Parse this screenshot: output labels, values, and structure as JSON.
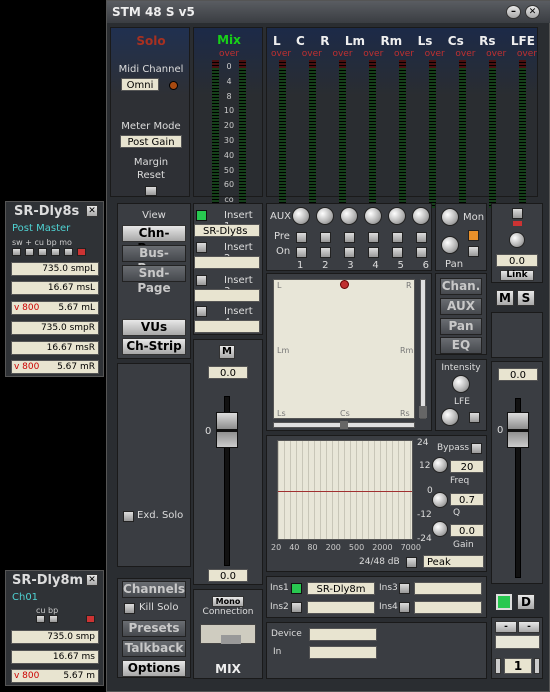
{
  "window": {
    "title": "STM 48 S v5"
  },
  "left": {
    "solo": "Solo",
    "midi_channel_label": "Midi Channel",
    "midi_channel": "Omni",
    "meter_mode_label": "Meter Mode",
    "meter_mode": "Post Gain",
    "margin_reset": "Margin\nReset"
  },
  "meters": {
    "mix_label": "Mix",
    "channels": [
      "L",
      "C",
      "R",
      "Lm",
      "Rm",
      "Ls",
      "Cs",
      "Rs",
      "LFE"
    ],
    "over": "over",
    "scale": [
      "0",
      "4",
      "8",
      "10",
      "20",
      "30",
      "40",
      "50",
      "60",
      "co"
    ]
  },
  "view": {
    "label": "View",
    "buttons": [
      "Chn-Page",
      "Bus-Page",
      "Snd-Page"
    ],
    "vus": "VUs",
    "chstrip": "Ch-Strip",
    "exd_solo": "Exd. Solo"
  },
  "inserts": {
    "items": [
      "Insert 1",
      "Insert 2",
      "Insert 3",
      "Insert 4"
    ],
    "ins1_value": "SR-Dly8s"
  },
  "fader": {
    "m": "M",
    "value_top": "0.0",
    "zero": "0",
    "value_bottom": "0.0"
  },
  "aux": {
    "label": "AUX",
    "pre": "Pre",
    "on": "On",
    "numbers": [
      "1",
      "2",
      "3",
      "4",
      "5",
      "6"
    ],
    "mon": "Mon",
    "pan": "Pan"
  },
  "panner": {
    "L": "L",
    "R": "R",
    "Lm": "Lm",
    "Rm": "Rm",
    "Ls": "Ls",
    "Cs": "Cs",
    "Rs": "Rs"
  },
  "side_buttons": [
    "Chan.",
    "AUX",
    "Pan",
    "EQ"
  ],
  "intensity": "Intensity",
  "lfe": "LFE",
  "eq": {
    "bypass": "Bypass",
    "gain_top": "24",
    "val12": "12",
    "val20": "20",
    "freq": "Freq",
    "val0": "0",
    "val07": "0.7",
    "q": "Q",
    "valm12": "-12",
    "val00": "0.0",
    "valm24": "-24",
    "gain": "Gain",
    "xaxis": [
      "20",
      "40",
      "80",
      "200",
      "500",
      "2000",
      "7000"
    ],
    "bits": "24/48 dB",
    "peak": "Peak"
  },
  "nav": {
    "channels": "Channels",
    "kill_solo": "Kill Solo",
    "presets": "Presets",
    "talkback": "Talkback",
    "options": "Options"
  },
  "mono": {
    "label": "Mono",
    "connection": "Connection",
    "mix": "MIX"
  },
  "ins_row": {
    "ins1": "Ins1",
    "ins1v": "SR-Dly8m",
    "ins2": "Ins2",
    "ins3": "Ins3",
    "ins4": "Ins4"
  },
  "device": {
    "device": "Device",
    "in": "In"
  },
  "right": {
    "val": "0.0",
    "link": "Link",
    "m": "M",
    "s": "S",
    "fader_val": "0.0",
    "zero": "0",
    "d": "D",
    "minus1": "-",
    "minus2": "-",
    "one": "1"
  },
  "plugin1": {
    "title": "SR-Dly8s",
    "sub": "Post Master",
    "hdr": "sw + cu bp mo",
    "r1": "735.0  smpL",
    "r2": "16.67 msL",
    "r3a": "v 800",
    "r3b": "5.67 mL",
    "r4": "735.0  smpR",
    "r5": "16.67 msR",
    "r6a": "v 800",
    "r6b": "5.67 mR"
  },
  "plugin2": {
    "title": "SR-Dly8m",
    "sub": "Ch01",
    "hdr": "cu bp",
    "r1": "735.0  smp",
    "r2": "16.67 ms",
    "r3a": "v 800",
    "r3b": "5.67 m"
  }
}
